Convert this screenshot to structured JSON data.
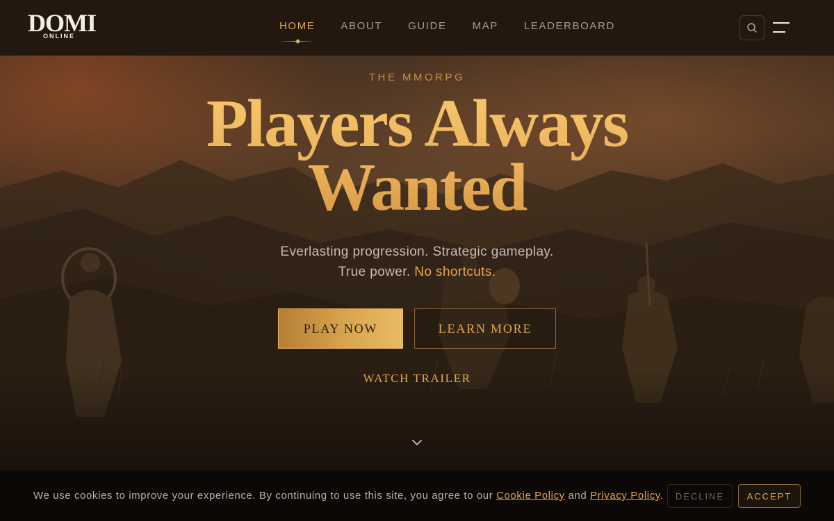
{
  "brand": {
    "logo_main": "DOMI",
    "logo_sub": "ONLINE"
  },
  "nav": {
    "items": [
      {
        "label": "HOME",
        "active": true
      },
      {
        "label": "ABOUT",
        "active": false
      },
      {
        "label": "GUIDE",
        "active": false
      },
      {
        "label": "MAP",
        "active": false
      },
      {
        "label": "LEADERBOARD",
        "active": false
      }
    ],
    "icons": [
      "search-icon",
      "menu-icon"
    ]
  },
  "hero": {
    "eyebrow": "THE MMORPG",
    "headline_line1": "Players Always",
    "headline_line2": "Wanted",
    "subline_line1": "Everlasting progression. Strategic gameplay.",
    "subline_line2_prefix": "True power. ",
    "subline_line2_highlight": "No shortcuts.",
    "primary_button": "PLAY NOW",
    "secondary_button": "LEARN MORE",
    "trailer_link": "WATCH TRAILER",
    "scroll_icon": "chevron-down-icon"
  },
  "cookie_bar": {
    "message_prefix": "We use cookies to improve your experience. By continuing to use this site, you agree to our ",
    "cookie_policy_link": "Cookie Policy",
    "message_middle": " and ",
    "privacy_policy_link": "Privacy Policy",
    "message_suffix": ".",
    "decline_label": "DECLINE",
    "accept_label": "ACCEPT"
  },
  "colors": {
    "accent_gold": "#e0a750",
    "nav_bg": "#221810",
    "cookie_bg": "#0b0806"
  }
}
